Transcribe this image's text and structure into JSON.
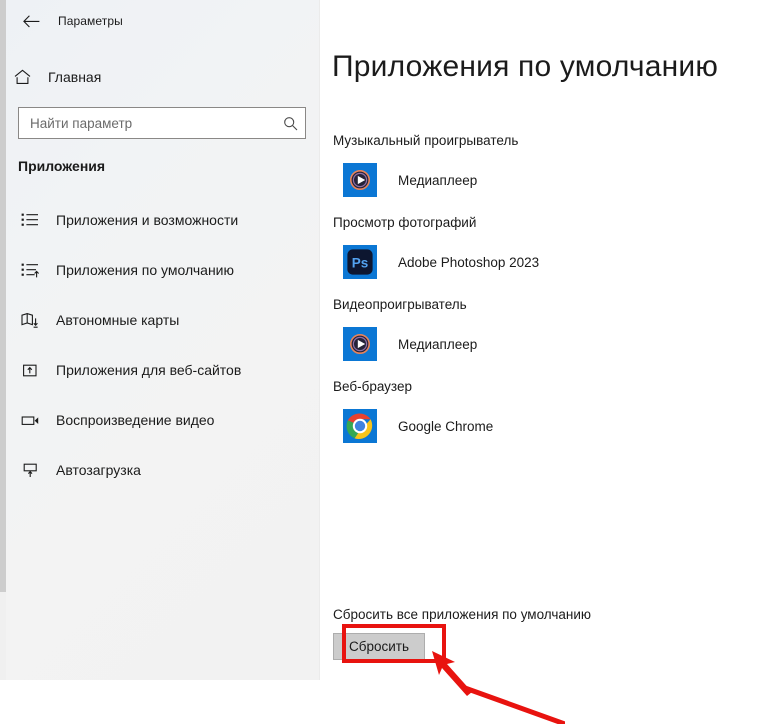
{
  "window": {
    "title": "Параметры",
    "back_icon": "back-arrow-icon"
  },
  "sidebar": {
    "home": {
      "label": "Главная",
      "icon": "home-icon"
    },
    "search": {
      "placeholder": "Найти параметр",
      "value": "",
      "icon": "search-icon"
    },
    "section_title": "Приложения",
    "items": [
      {
        "label": "Приложения и возможности",
        "icon": "apps-list-icon",
        "selected": false
      },
      {
        "label": "Приложения по умолчанию",
        "icon": "default-apps-icon",
        "selected": true
      },
      {
        "label": "Автономные карты",
        "icon": "offline-maps-icon",
        "selected": false
      },
      {
        "label": "Приложения для веб-сайтов",
        "icon": "apps-for-websites-icon",
        "selected": false
      },
      {
        "label": "Воспроизведение видео",
        "icon": "video-playback-icon",
        "selected": false
      },
      {
        "label": "Автозагрузка",
        "icon": "startup-icon",
        "selected": false
      }
    ]
  },
  "main": {
    "page_title": "Приложения по умолчанию",
    "groups": [
      {
        "label": "Музыкальный проигрыватель",
        "app_name": "Медиаплеер",
        "app_icon": "media-player-icon"
      },
      {
        "label": "Просмотр фотографий",
        "app_name": "Adobe Photoshop 2023",
        "app_icon": "photoshop-icon"
      },
      {
        "label": "Видеопроигрыватель",
        "app_name": "Медиаплеер",
        "app_icon": "media-player-icon"
      },
      {
        "label": "Веб-браузер",
        "app_name": "Google Chrome",
        "app_icon": "chrome-icon"
      }
    ],
    "reset": {
      "label": "Сбросить все приложения по умолчанию",
      "button_label": "Сбросить"
    }
  },
  "annotation": {
    "highlight_color": "#e8130f",
    "arrow_icon": "red-arrow-icon"
  },
  "colors": {
    "accent": "#0078d7",
    "sidebar_bg": "#f2f2f2",
    "text": "#1b1b1b"
  }
}
